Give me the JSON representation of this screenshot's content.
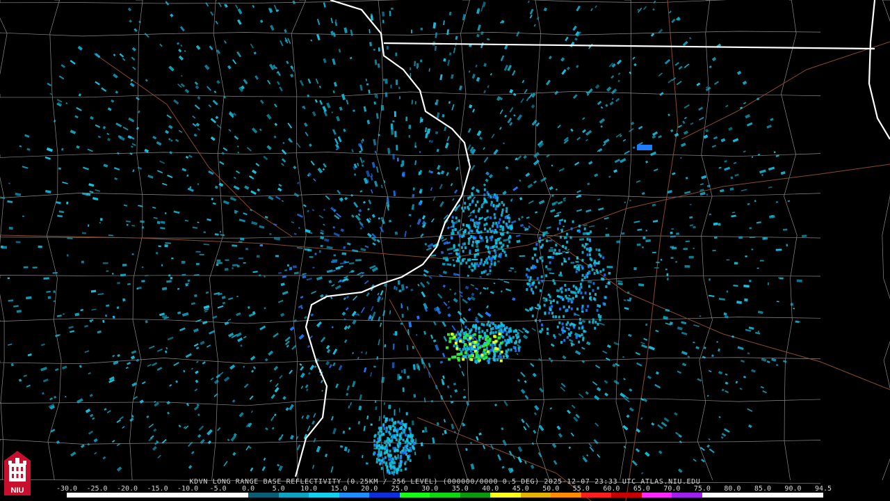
{
  "product": {
    "caption": "KDVN LONG RANGE BASE REFLECTIVITY (0.25KM / 256 LEVEL) (000000/0000 0.5 DEG) 2025-12-07 23:33 UTC   ATLAS.NIU.EDU"
  },
  "scale": {
    "labels": [
      "-30.0",
      "-25.0",
      "-20.0",
      "-15.0",
      "-10.0",
      "-5.0",
      "0.0",
      "5.0",
      "10.0",
      "15.0",
      "20.0",
      "25.0",
      "30.0",
      "35.0",
      "40.0",
      "45.0",
      "50.0",
      "55.0",
      "60.0",
      "65.0",
      "70.0",
      "75.0",
      "80.0",
      "85.0",
      "90.0",
      "94.5"
    ],
    "colors": [
      "#ffffff",
      "#ffffff",
      "#ffffff",
      "#ffffff",
      "#ffffff",
      "#ffffff",
      "#0a5f74",
      "#0ea3c2",
      "#12d1f0",
      "#1e8fff",
      "#0d2fe0",
      "#14ff14",
      "#10d810",
      "#0a9a0a",
      "#ffff1e",
      "#e6b400",
      "#ff8c00",
      "#ff1e1e",
      "#c80000",
      "#ff28ff",
      "#a020f0",
      "#ffffff",
      "#ffffff",
      "#ffffff",
      "#ffffff"
    ]
  },
  "logo": {
    "text": "NIU",
    "colors": {
      "badge": "#c8102e",
      "emblem": "#ffffff"
    }
  },
  "map": {
    "colors": {
      "background": "#000000",
      "state-border": "#ffffff",
      "county-line": "#8a8a8a",
      "highway": "#8b4a2a",
      "echo-light": "#14c8e8",
      "echo-medium": "#1e7cff",
      "echo-strong": "#2fe82f",
      "echo-core": "#e8ff20"
    }
  }
}
